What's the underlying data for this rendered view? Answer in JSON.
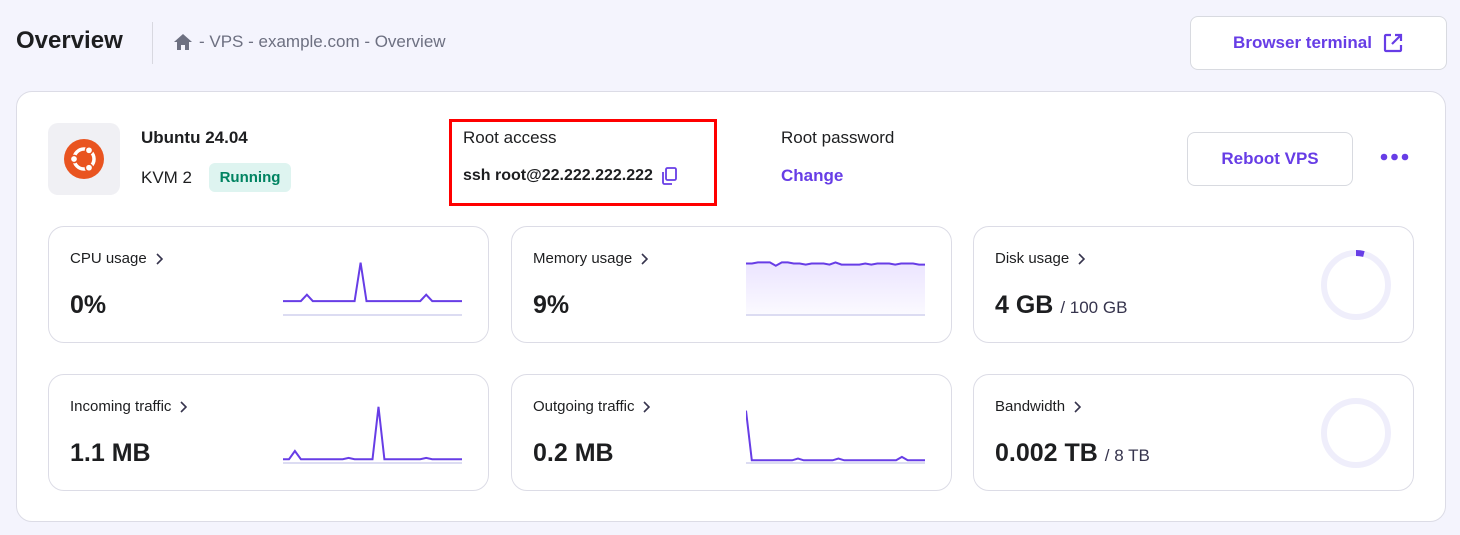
{
  "header": {
    "title": "Overview",
    "breadcrumb": "- VPS - example.com - Overview",
    "browser_terminal": "Browser terminal"
  },
  "server": {
    "os": "Ubuntu 24.04",
    "plan": "KVM 2",
    "status": "Running",
    "root_access_label": "Root access",
    "ssh_command": "ssh root@22.222.222.222",
    "root_password_label": "Root password",
    "change_label": "Change",
    "reboot_label": "Reboot VPS"
  },
  "colors": {
    "accent": "#673de6",
    "ubuntu": "#e95420",
    "running": "#008361"
  },
  "metrics": [
    {
      "label": "CPU usage",
      "value": "0%",
      "series": [
        2,
        2,
        2,
        2,
        3,
        2,
        2,
        2,
        2,
        2,
        2,
        2,
        2,
        8,
        2,
        2,
        2,
        2,
        2,
        2,
        2,
        2,
        2,
        2,
        3,
        2,
        2,
        2,
        2,
        2,
        2
      ]
    },
    {
      "label": "Memory usage",
      "value": "9%",
      "series": [
        45,
        45,
        46,
        46,
        46,
        43,
        46,
        46,
        45,
        45,
        44,
        45,
        45,
        45,
        44,
        46,
        44,
        44,
        44,
        44,
        45,
        44,
        45,
        45,
        45,
        44,
        45,
        45,
        45,
        44,
        44
      ]
    },
    {
      "label": "Disk usage",
      "value": "4 GB",
      "total": "/ 100 GB",
      "fraction": 0.04
    },
    {
      "label": "Incoming traffic",
      "value": "1.1 MB",
      "series": [
        2,
        2,
        8,
        2,
        2,
        2,
        2,
        2,
        2,
        2,
        2,
        3,
        2,
        2,
        2,
        2,
        40,
        2,
        2,
        2,
        2,
        2,
        2,
        2,
        3,
        2,
        2,
        2,
        2,
        2,
        2
      ]
    },
    {
      "label": "Outgoing traffic",
      "value": "0.2 MB",
      "series": [
        30,
        1,
        1,
        1,
        1,
        1,
        1,
        1,
        1,
        2,
        1,
        1,
        1,
        1,
        1,
        1,
        2,
        1,
        1,
        1,
        1,
        1,
        1,
        1,
        1,
        1,
        1,
        3,
        1,
        1,
        1,
        1
      ]
    },
    {
      "label": "Bandwidth",
      "value": "0.002 TB",
      "total": "/ 8 TB",
      "fraction": 0.00025
    }
  ]
}
